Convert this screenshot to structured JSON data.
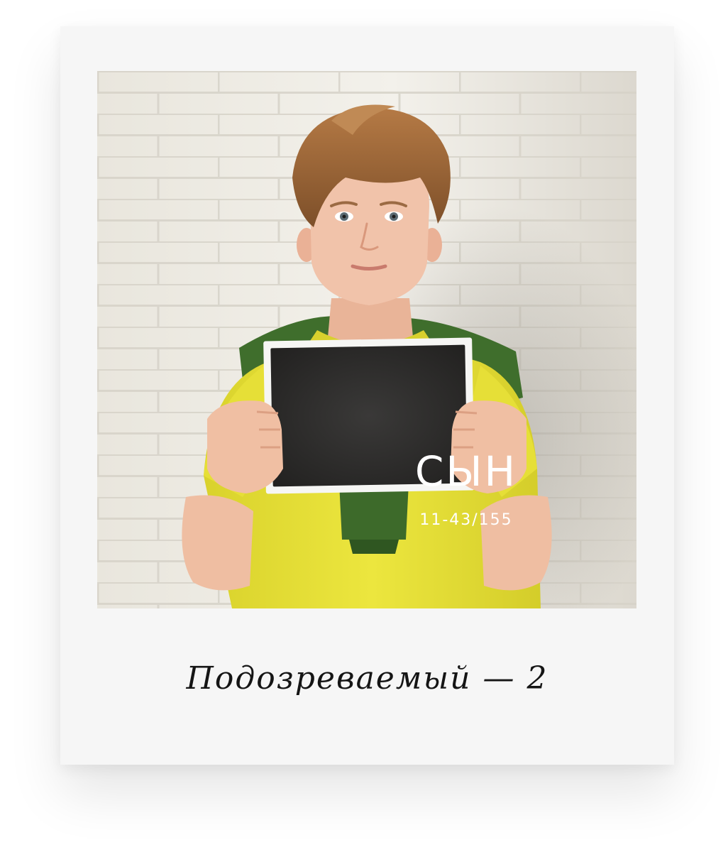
{
  "sign": {
    "title": "СЫН",
    "number": "11-43/155"
  },
  "caption": {
    "text": "Подозреваемый — 2"
  },
  "colors": {
    "card": "#f6f6f6",
    "wall": "#eceae4",
    "shirt": "#e8e23a",
    "sweater": "#3f6e2c",
    "sign": "#2e2d2c",
    "hair": "#9a6436",
    "skin": "#f1c3aa"
  }
}
